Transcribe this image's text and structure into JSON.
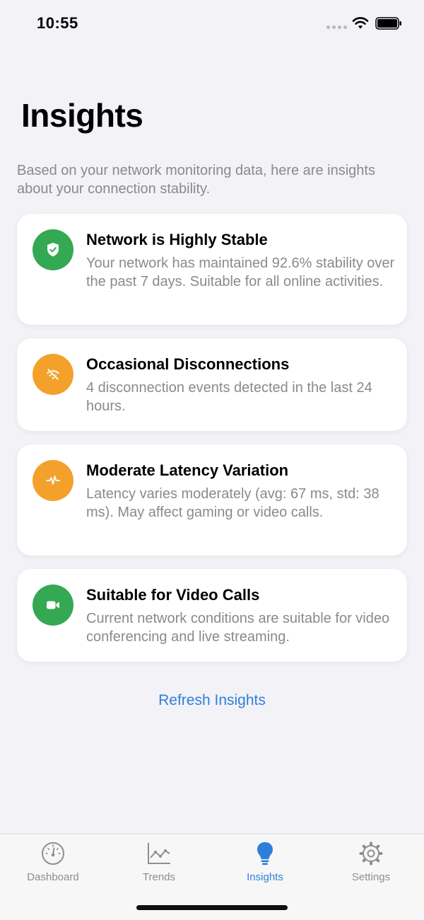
{
  "status": {
    "time": "10:55"
  },
  "header": {
    "title": "Insights"
  },
  "intro": "Based on your network monitoring data, here are insights about your connection stability.",
  "cards": [
    {
      "title": "Network is Highly Stable",
      "text": "Your network has maintained 92.6% stability over the past 7 days. Suitable for all online activities.",
      "icon": "shield-check-icon",
      "color": "#34a853"
    },
    {
      "title": "Occasional Disconnections",
      "text": "4 disconnection events detected in the last 24 hours.",
      "icon": "wifi-off-icon",
      "color": "#f4a12b"
    },
    {
      "title": "Moderate Latency Variation",
      "text": "Latency varies moderately (avg: 67 ms, std: 38 ms). May affect gaming or video calls.",
      "icon": "waveform-icon",
      "color": "#f4a12b"
    },
    {
      "title": "Suitable for Video Calls",
      "text": "Current network conditions are suitable for video conferencing and live streaming.",
      "icon": "video-camera-icon",
      "color": "#34a853"
    }
  ],
  "refresh_label": "Refresh Insights",
  "tabs": [
    {
      "label": "Dashboard",
      "icon": "gauge-icon",
      "active": false
    },
    {
      "label": "Trends",
      "icon": "line-chart-icon",
      "active": false
    },
    {
      "label": "Insights",
      "icon": "lightbulb-icon",
      "active": true
    },
    {
      "label": "Settings",
      "icon": "gear-icon",
      "active": false
    }
  ],
  "colors": {
    "accent": "#2f7fd9",
    "green": "#34a853",
    "orange": "#f4a12b",
    "background": "#f2f2f7"
  }
}
